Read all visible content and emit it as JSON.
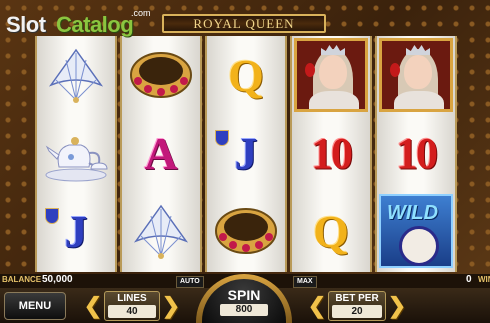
{
  "logo": {
    "slot": "Slot",
    "catalog": "Catalog",
    "com": ".com"
  },
  "game": {
    "title": "ROYAL QUEEN"
  },
  "reels": [
    [
      "fan",
      "teapot",
      "J"
    ],
    [
      "bracelet",
      "A",
      "fan"
    ],
    [
      "Q",
      "J",
      "bracelet"
    ],
    [
      "queen",
      "10",
      "Q"
    ],
    [
      "queen",
      "10",
      "wild"
    ]
  ],
  "symbols": {
    "q": "Q",
    "j": "J",
    "a": "A",
    "ten": "10",
    "wild": "WILD"
  },
  "status": {
    "balance_label": "BALANCE",
    "balance_value": "50,000",
    "win_value": "0",
    "win_label": "WIN"
  },
  "controls": {
    "menu": "MENU",
    "lines_label": "LINES",
    "lines_value": "40",
    "auto": "AUTO",
    "max": "MAX",
    "spin_label": "SPIN",
    "spin_value": "800",
    "bet_label": "BET PER",
    "bet_value": "20"
  },
  "colors": {
    "accent": "#d9b25b",
    "ten": "#d31d1d",
    "q": "#f2b21a",
    "j": "#2f3fbf",
    "a": "#c2187a"
  }
}
